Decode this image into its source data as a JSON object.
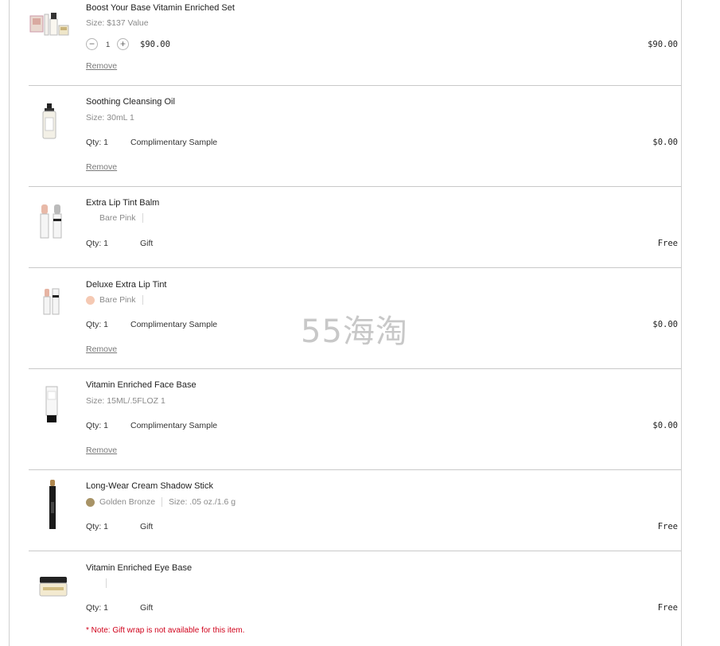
{
  "items": [
    {
      "name": "Boost Your Base Vitamin Enriched Set",
      "size": "Size: $137 Value",
      "quantity": "1",
      "unit_price": "$90.00",
      "price": "$90.00",
      "remove": "Remove"
    },
    {
      "name": "Soothing Cleansing Oil",
      "size": "Size: 30mL 1",
      "qty": "Qty: 1",
      "type": "Complimentary Sample",
      "price": "$0.00",
      "remove": "Remove"
    },
    {
      "name": "Extra Lip Tint Balm",
      "shade": "Bare Pink",
      "qty": "Qty: 1",
      "type": "Gift",
      "price": "Free"
    },
    {
      "name": "Deluxe Extra Lip Tint",
      "shade": "Bare Pink",
      "shade_color": "#f5c9b3",
      "qty": "Qty: 1",
      "type": "Complimentary Sample",
      "price": "$0.00",
      "remove": "Remove"
    },
    {
      "name": "Vitamin Enriched Face Base",
      "size": "Size: 15ML/.5FLOZ 1",
      "qty": "Qty: 1",
      "type": "Complimentary Sample",
      "price": "$0.00",
      "remove": "Remove"
    },
    {
      "name": "Long-Wear Cream Shadow Stick",
      "shade": "Golden Bronze",
      "shade_color": "#a89366",
      "size": "Size: .05 oz./1.6 g",
      "qty": "Qty: 1",
      "type": "Gift",
      "price": "Free"
    },
    {
      "name": "Vitamin Enriched Eye Base",
      "qty": "Qty: 1",
      "type": "Gift",
      "price": "Free",
      "note": "* Note: Gift wrap is not available for this item."
    }
  ],
  "watermark": "55海淘",
  "colors": {
    "note": "#d0021b",
    "separator": "#c9c9c9",
    "muted_text": "#8a8a8a"
  }
}
